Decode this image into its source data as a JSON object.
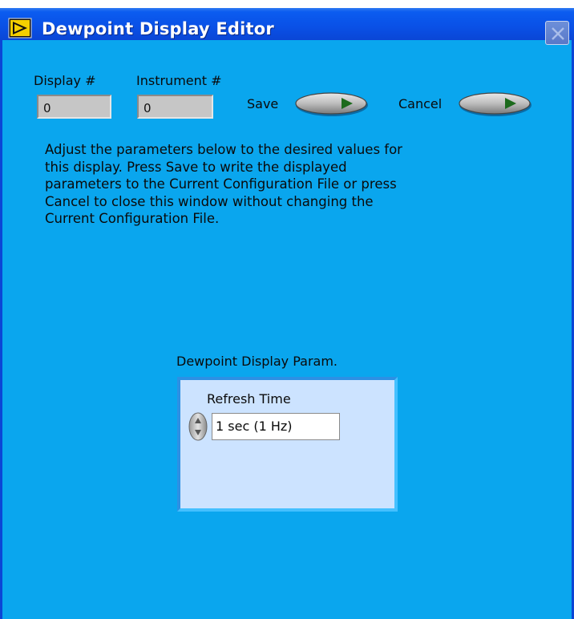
{
  "window": {
    "title": "Dewpoint Display Editor",
    "icon": "labview-run-arrow-icon",
    "close_icon": "close-x-icon"
  },
  "header": {
    "display_label": "Display #",
    "display_value": "0",
    "instrument_label": "Instrument #",
    "instrument_value": "0",
    "save_label": "Save",
    "cancel_label": "Cancel"
  },
  "instructions": "Adjust the parameters below to the desired values for\nthis display.  Press Save to write the displayed\nparameters to the Current Configuration File or press\nCancel to close this window without changing the\nCurrent Configuration File.",
  "params": {
    "cluster_label": "Dewpoint Display Param.",
    "refresh_label": "Refresh Time",
    "refresh_value": "1 sec (1 Hz)"
  },
  "colors": {
    "background": "#0aa6ee",
    "titlebar": "#0a50e6",
    "cluster_fill": "#cce3ff"
  }
}
